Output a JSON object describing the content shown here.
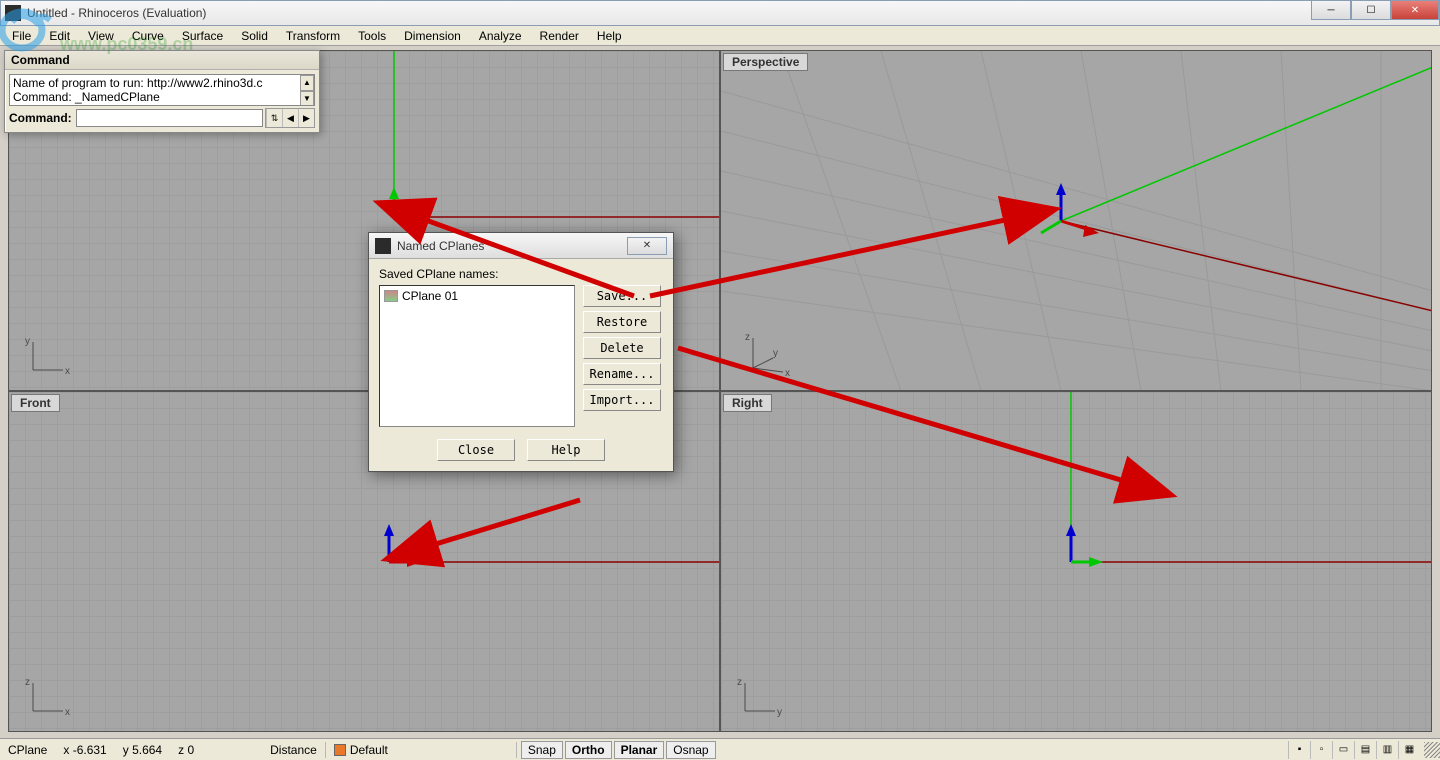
{
  "window": {
    "title": "Untitled - Rhinoceros (Evaluation)",
    "watermark": "www.pc0359.cn"
  },
  "menu": {
    "items": [
      "File",
      "Edit",
      "View",
      "Curve",
      "Surface",
      "Solid",
      "Transform",
      "Tools",
      "Dimension",
      "Analyze",
      "Render",
      "Help"
    ]
  },
  "command_panel": {
    "title": "Command",
    "history_line1": "Name of program to run: http://www2.rhino3d.c",
    "history_line2": "Command: _NamedCPlane",
    "prompt_label": "Command:",
    "value": ""
  },
  "viewports": {
    "top_left_label": "",
    "top_right_label": "Perspective",
    "bottom_left_label": "Front",
    "bottom_right_label": "Right",
    "axis_x": "x",
    "axis_y": "y",
    "axis_z": "z"
  },
  "dialog": {
    "title": "Named CPlanes",
    "section_label": "Saved CPlane names:",
    "items": [
      "CPlane 01"
    ],
    "buttons": {
      "save": "Save...",
      "restore": "Restore",
      "delete": "Delete",
      "rename": "Rename...",
      "import": "Import..."
    },
    "close": "Close",
    "help": "Help"
  },
  "status": {
    "cplane_label": "CPlane",
    "x_label": "x",
    "x_val": "-6.631",
    "y_label": "y",
    "y_val": "5.664",
    "z_label": "z",
    "z_val": "0",
    "distance_label": "Distance",
    "layer_label": "Default",
    "toggles": {
      "snap": "Snap",
      "ortho": "Ortho",
      "planar": "Planar",
      "osnap": "Osnap"
    }
  }
}
